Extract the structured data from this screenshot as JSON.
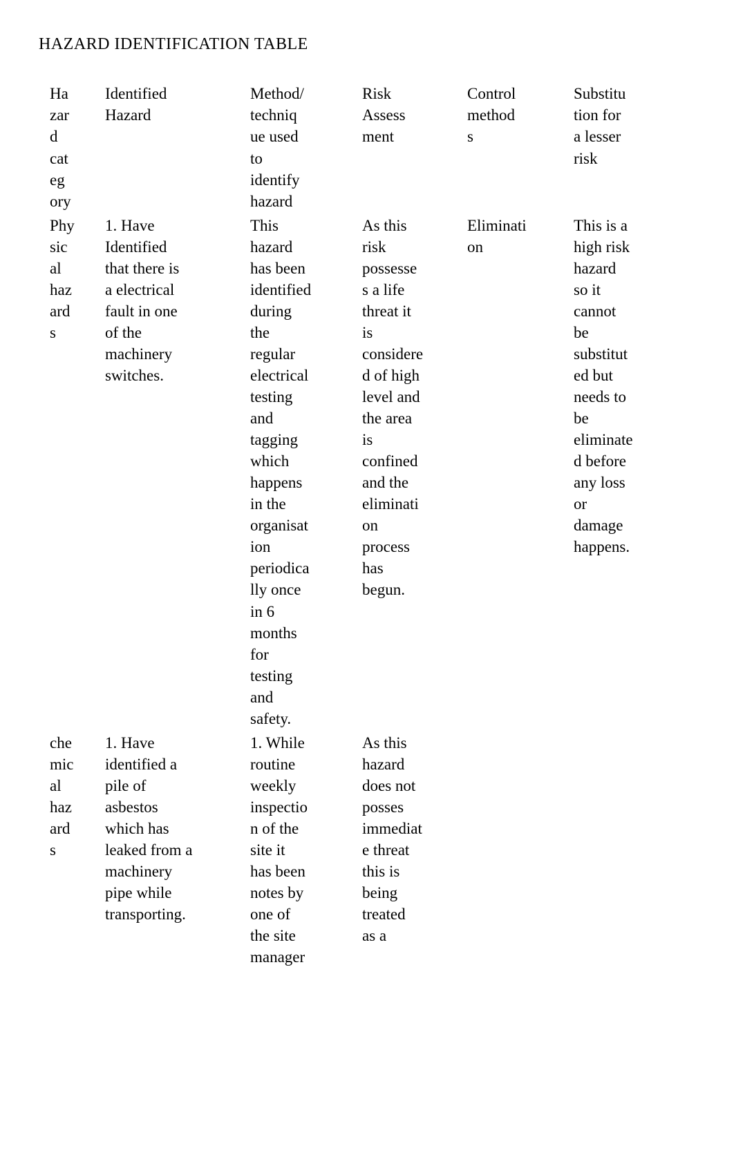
{
  "title": "HAZARD IDENTIFICATION TABLE",
  "headers": {
    "c1": "Ha\nzar\nd\ncat\neg\nory",
    "c2": "Identified\nHazard",
    "c3": "Method/\ntechniq\nue used\nto\nidentify\nhazard",
    "c4": "Risk\nAssess\nment",
    "c5": "Control\nmethod\ns",
    "c6": "Substitu\ntion for\na lesser\nrisk"
  },
  "rows": [
    {
      "c1": "Phy\nsic\nal\nhaz\nard\ns",
      "c2": "1. Have\nIdentified\nthat there is\na electrical\nfault in one\nof the\nmachinery\nswitches.",
      "c3": "This\nhazard\nhas been\nidentified\nduring\nthe\nregular\nelectrical\ntesting\nand\ntagging\nwhich\nhappens\nin the\norganisat\nion\nperiodica\nlly once\nin 6\nmonths\nfor\ntesting\nand\nsafety.",
      "c4": "As this\nrisk\npossesse\ns a life\nthreat it\nis\nconsidere\nd of high\nlevel and\nthe area\nis\nconfined\nand the\neliminati\non\nprocess\nhas\nbegun.",
      "c5": "Eliminati\non",
      "c6": "This is a\nhigh risk\nhazard\nso it\ncannot\nbe\nsubstitut\ned but\nneeds to\nbe\neliminate\nd before\nany loss\nor\ndamage\nhappens."
    },
    {
      "c1": "che\nmic\nal\nhaz\nard\ns",
      "c2": "1. Have\nidentified a\npile of\nasbestos\nwhich has\nleaked from a\nmachinery\npipe while\ntransporting.",
      "c3": "1. While\nroutine\nweekly\ninspectio\nn of the\nsite it\nhas been\nnotes by\none of\nthe site\nmanager",
      "c4": "As this\nhazard\ndoes not\nposses\nimmediat\ne threat\nthis is\nbeing\ntreated\nas a",
      "c5": "",
      "c6": ""
    }
  ]
}
